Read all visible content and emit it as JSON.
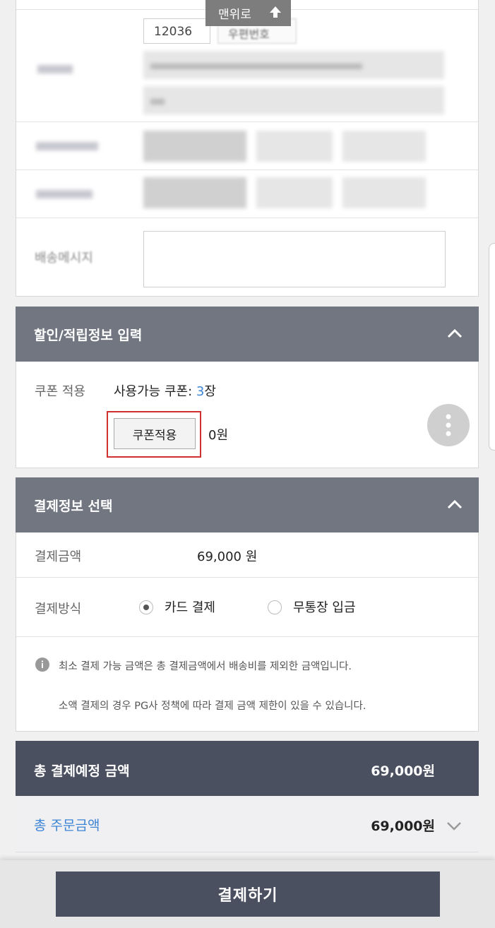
{
  "top_button": {
    "label": "맨위로"
  },
  "address": {
    "zipcode": "12036",
    "zip_button": "우편번호"
  },
  "delivery_message": {
    "label": "배송메시지",
    "value": ""
  },
  "discount": {
    "title": "할인/적립정보 입력",
    "coupon_label": "쿠폰 적용",
    "available_text": "사용가능 쿠폰:",
    "available_count": "3",
    "available_unit": "장",
    "apply_button": "쿠폰적용",
    "amount": "0원"
  },
  "payment": {
    "title": "결제정보 선택",
    "amount_label": "결제금액",
    "amount_value": "69,000 원",
    "method_label": "결제방식",
    "methods": [
      {
        "label": "카드 결제",
        "selected": true
      },
      {
        "label": "무통장 입금",
        "selected": false
      }
    ],
    "notice_1": "최소 결제 가능 금액은 총 결제금액에서 배송비를 제외한 금액입니다.",
    "notice_2": "소액 결제의 경우 PG사 정책에 따라 결제 금액 제한이 있을 수 있습니다."
  },
  "summary": {
    "total_label": "총 결제예정 금액",
    "total_value": "69,000원",
    "order_label": "총 주문금액",
    "order_value": "69,000원"
  },
  "pay_button": {
    "label": "결제하기"
  },
  "colors": {
    "section_header": "#717681",
    "total_bar": "#4b5061",
    "pay_button": "#4b5061",
    "link_blue": "#3c84d6",
    "coupon_highlight": "#d0302f"
  },
  "icons": [
    "arrow-up-icon",
    "chevron-up-icon",
    "more-vertical-icon",
    "info-icon",
    "chevron-down-icon"
  ]
}
